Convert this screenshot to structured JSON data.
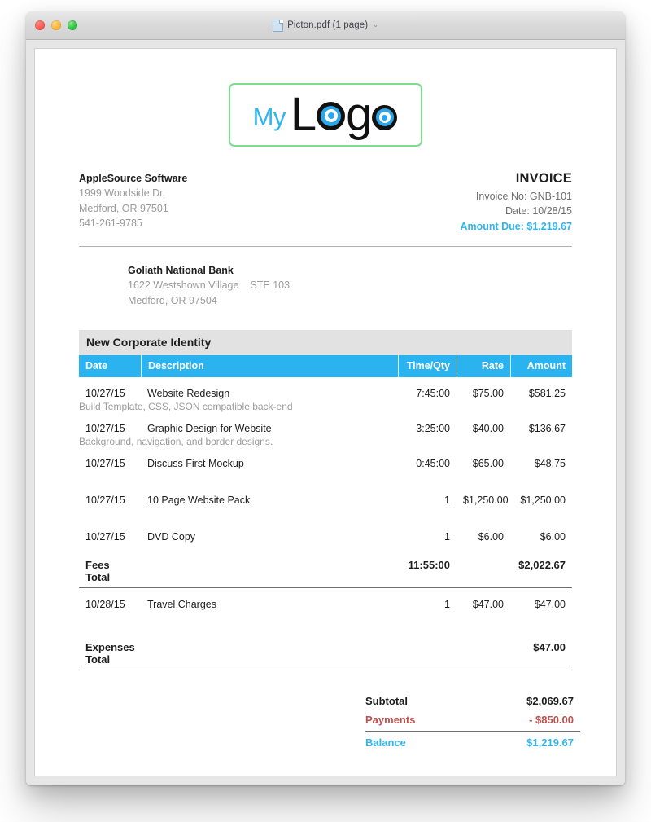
{
  "window": {
    "title": "Picton.pdf (1 page)",
    "doc_icon": "pdf-document-icon",
    "chevron": "⌄",
    "traffic_lights": [
      "close",
      "minimize",
      "zoom"
    ]
  },
  "logo": {
    "my_text": "My",
    "logo_text": "Logo",
    "my_color": "#31b5ef",
    "border_color": "#7ddc8f"
  },
  "from": {
    "name": "AppleSource Software",
    "line1": "1999 Woodside Dr.",
    "line2": "Medford, OR 97501",
    "phone": "541-261-9785"
  },
  "invoice_meta": {
    "title": "INVOICE",
    "invoice_no": "Invoice No: GNB-101",
    "date": "Date: 10/28/15",
    "amount_due": "Amount Due: $1,219.67",
    "accent_color": "#31b5ef"
  },
  "bill_to": {
    "name": "Goliath National Bank",
    "line1": "1622 Westshown Village",
    "line1b": "STE 103",
    "line2": "Medford, OR 97504"
  },
  "table": {
    "section_title": "New Corporate Identity",
    "header_color": "#2bb3ef",
    "columns": {
      "date": "Date",
      "description": "Description",
      "qty": "Time/Qty",
      "rate": "Rate",
      "amount": "Amount"
    },
    "rows": [
      {
        "date": "10/27/15",
        "description": "Website Redesign",
        "note": "Build Template, CSS, JSON compatible back-end",
        "qty": "7:45:00",
        "rate": "$75.00",
        "amount": "$581.25"
      },
      {
        "date": "10/27/15",
        "description": "Graphic Design for Website",
        "note": "Background, navigation, and border designs.",
        "qty": "3:25:00",
        "rate": "$40.00",
        "amount": "$136.67"
      },
      {
        "date": "10/27/15",
        "description": "Discuss First Mockup",
        "note": "",
        "qty": "0:45:00",
        "rate": "$65.00",
        "amount": "$48.75"
      },
      {
        "date": "10/27/15",
        "description": "10 Page Website Pack",
        "note": "",
        "qty": "1",
        "rate": "$1,250.00",
        "amount": "$1,250.00"
      },
      {
        "date": "10/27/15",
        "description": "DVD Copy",
        "note": "",
        "qty": "1",
        "rate": "$6.00",
        "amount": "$6.00"
      }
    ],
    "fees_total": {
      "label": "Fees Total",
      "qty": "11:55:00",
      "amount": "$2,022.67"
    },
    "expense_rows": [
      {
        "date": "10/28/15",
        "description": "Travel Charges",
        "note": "",
        "qty": "1",
        "rate": "$47.00",
        "amount": "$47.00"
      }
    ],
    "expenses_total": {
      "label": "Expenses Total",
      "qty": "",
      "amount": "$47.00"
    }
  },
  "summary": {
    "subtotal_label": "Subtotal",
    "subtotal_value": "$2,069.67",
    "payments_label": "Payments",
    "payments_value": "- $850.00",
    "payments_color": "#bf504e",
    "balance_label": "Balance",
    "balance_value": "$1,219.67",
    "balance_color": "#31b5ef"
  }
}
